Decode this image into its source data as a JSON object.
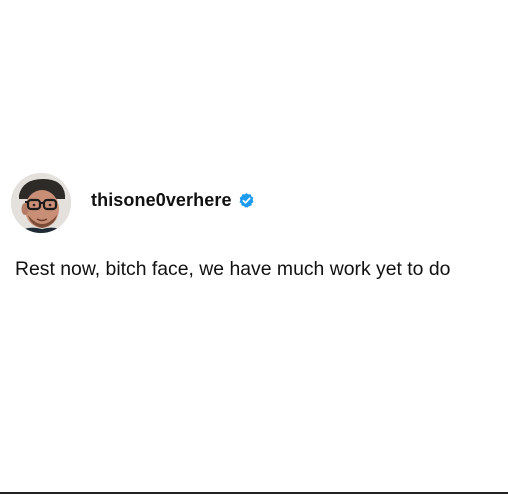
{
  "post": {
    "author": {
      "username": "thisone0verhere",
      "verified": true,
      "avatar_icon": "profile-photo-man-with-glasses-and-cap"
    },
    "text": "Rest now, bitch face, we have much work yet to do"
  },
  "colors": {
    "background": "#ffffff",
    "text": "#111111",
    "verified_badge": "#1d9bf0"
  }
}
